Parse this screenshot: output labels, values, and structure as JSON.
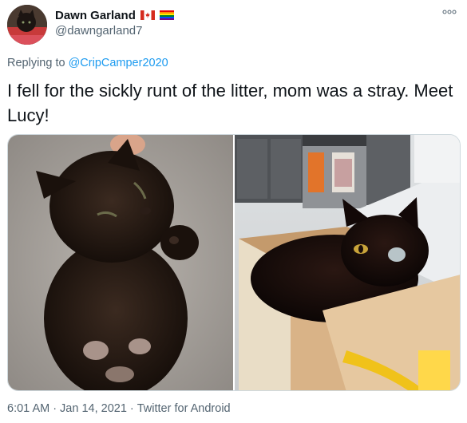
{
  "author": {
    "display_name": "Dawn Garland",
    "handle": "@dawngarland7",
    "badges": [
      "canada-flag-icon",
      "rainbow-flag-icon"
    ]
  },
  "reply": {
    "prefix": "Replying to ",
    "mention": "@CripCamper2020"
  },
  "tweet": {
    "text": "I fell for the sickly runt of the litter, mom was a stray. Meet Lucy!"
  },
  "media": {
    "count": 2
  },
  "footer": {
    "time": "6:01 AM",
    "sep1": "·",
    "date": "Jan 14, 2021",
    "sep2": "·",
    "source": "Twitter for Android"
  },
  "colors": {
    "link": "#1d9bf0",
    "secondary_text": "#536471",
    "primary_text": "#0f1419",
    "border": "#cfd9de"
  }
}
